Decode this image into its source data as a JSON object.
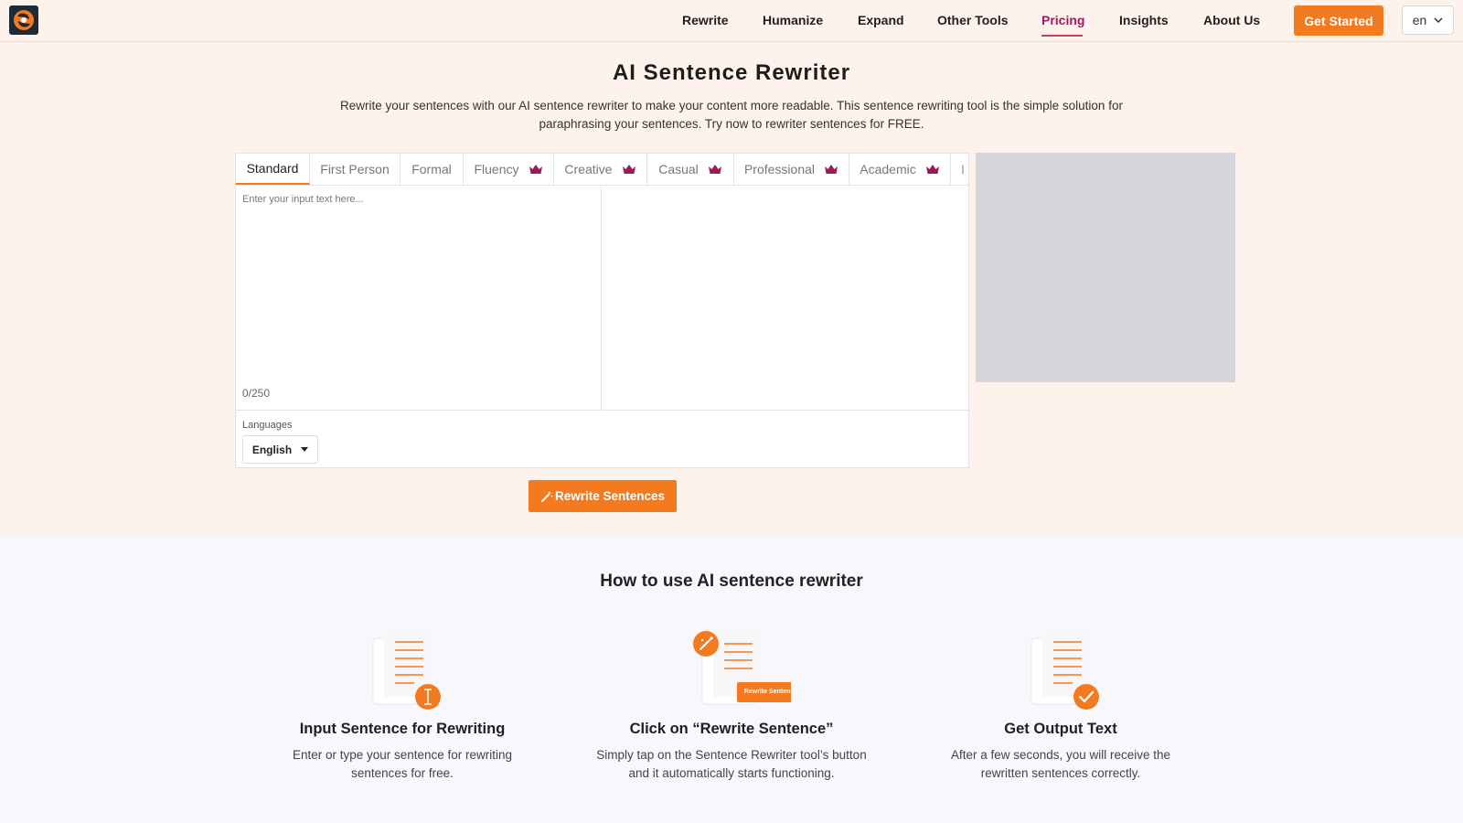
{
  "nav": {
    "links": [
      "Rewrite",
      "Humanize",
      "Expand",
      "Other Tools",
      "Pricing",
      "Insights",
      "About Us"
    ],
    "cta": "Get Started",
    "language": "en"
  },
  "hero": {
    "title": "AI Sentence Rewriter",
    "description_line1": "Rewrite your sentences with our AI sentence rewriter to make your content more readable. This sentence rewriting tool is the simple solution for",
    "description_line2": "paraphrasing your sentences. Try now to rewriter sentences for FREE."
  },
  "tool": {
    "tabs": [
      "Standard",
      "First Person",
      "Formal",
      "Fluency",
      "Creative",
      "Casual",
      "Professional",
      "Academic"
    ],
    "input_placeholder": "Enter your input text here...",
    "counter": "0/250",
    "languages_label": "Languages",
    "language_value": "English",
    "rewrite_button": "Rewrite Sentences"
  },
  "howto": {
    "title": "How to use AI sentence rewriter",
    "steps": [
      {
        "title": "Input Sentence for Rewriting",
        "desc_line1": "Enter or type your sentence for rewriting",
        "desc_line2": "sentences for free."
      },
      {
        "title": "Click on “Rewrite Sentence”",
        "desc_line1": "Simply tap on the Sentence Rewriter tool’s button",
        "desc_line2": "and it automatically starts functioning.",
        "badge": "Rewrite Sentence"
      },
      {
        "title": "Get Output Text",
        "desc_line1": "After a few seconds, you will receive the",
        "desc_line2": "rewritten sentences correctly."
      }
    ]
  },
  "colors": {
    "accent": "#f47a20",
    "premium": "#9c1a5a",
    "hero_bg": "#fdf3ec"
  }
}
